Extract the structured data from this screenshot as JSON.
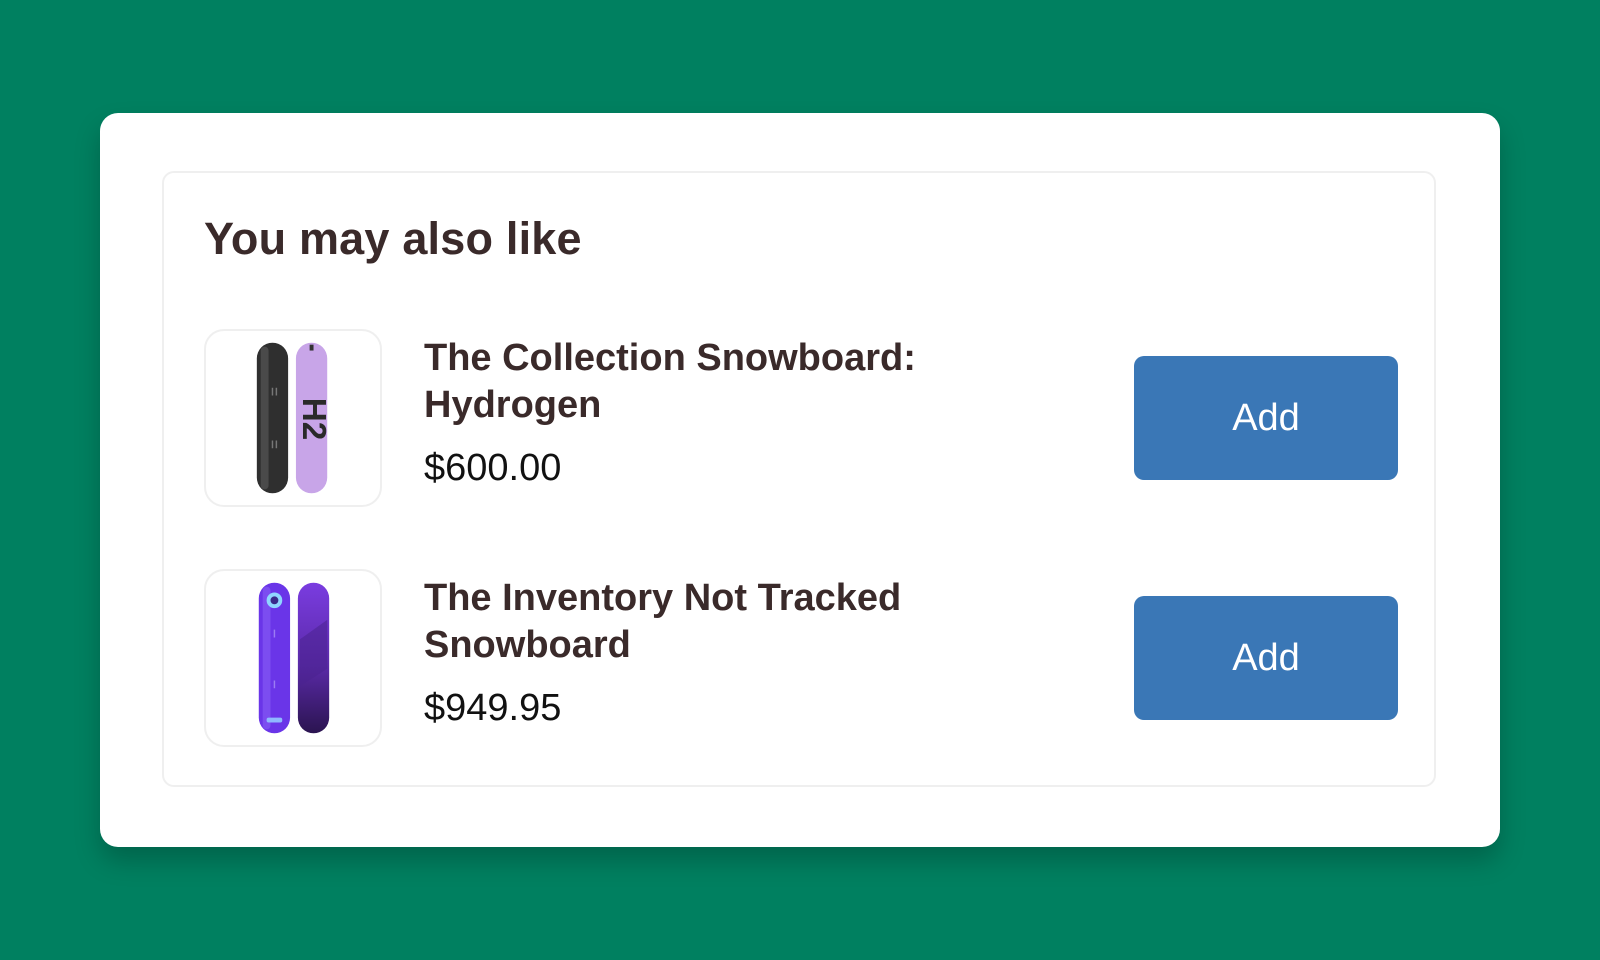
{
  "recommendations": {
    "heading": "You may also like",
    "products": [
      {
        "title": "The Collection Snowboard: Hydrogen",
        "price": "$600.00",
        "button_label": "Add",
        "image_icon": "snowboard-hydrogen-icon",
        "image_graphic_text": "H2"
      },
      {
        "title": "The Inventory Not Tracked Snowboard",
        "price": "$949.95",
        "button_label": "Add",
        "image_icon": "snowboard-purple-icon"
      }
    ]
  },
  "colors": {
    "background": "#008060",
    "card": "#ffffff",
    "button": "#3a77b6",
    "heading_text": "#3a2a2a"
  }
}
